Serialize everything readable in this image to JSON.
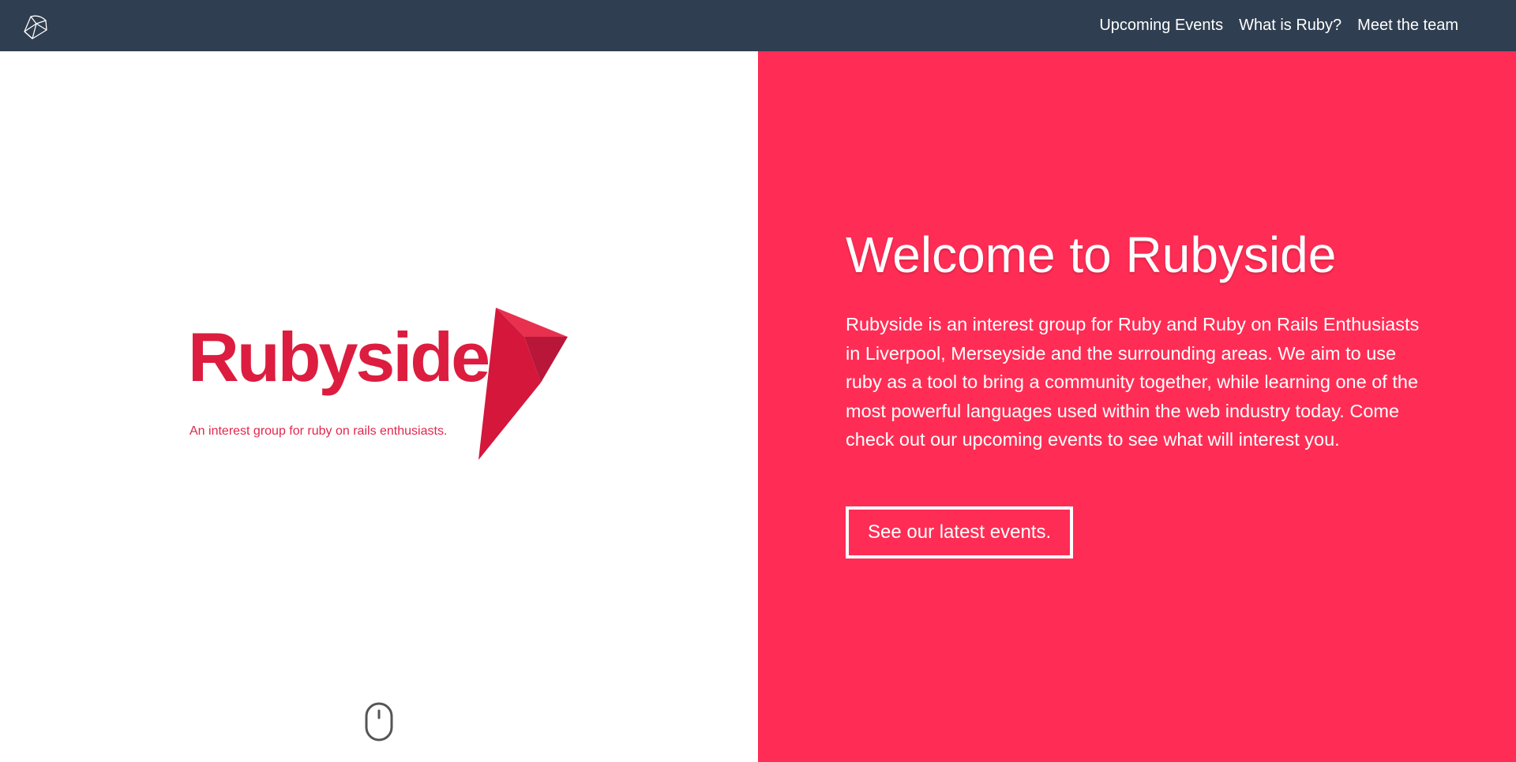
{
  "navbar": {
    "logo_icon": "ruby-gem-icon",
    "links": [
      {
        "label": "Upcoming Events"
      },
      {
        "label": "What is Ruby?"
      },
      {
        "label": "Meet the team"
      }
    ]
  },
  "brand": {
    "logo_text": "Rubyside",
    "tagline": "An interest group for ruby on rails enthusiasts."
  },
  "hero": {
    "title": "Welcome to Rubyside",
    "description": "Rubyside is an interest group for Ruby and Ruby on Rails Enthusiasts in Liverpool, Merseyside and the surrounding areas. We aim to use ruby as a tool to bring a community together, while learning one of the most powerful languages used within the web industry today. Come check out our upcoming events to see what will interest you.",
    "cta_label": "See our latest events."
  },
  "scroll_indicator": {
    "icon": "mouse-scroll-icon"
  },
  "colors": {
    "navbar_bg": "#2f3e50",
    "accent_pink": "#ff2d55",
    "brand_red": "#dc1d3f",
    "text_light": "#ffffff"
  }
}
